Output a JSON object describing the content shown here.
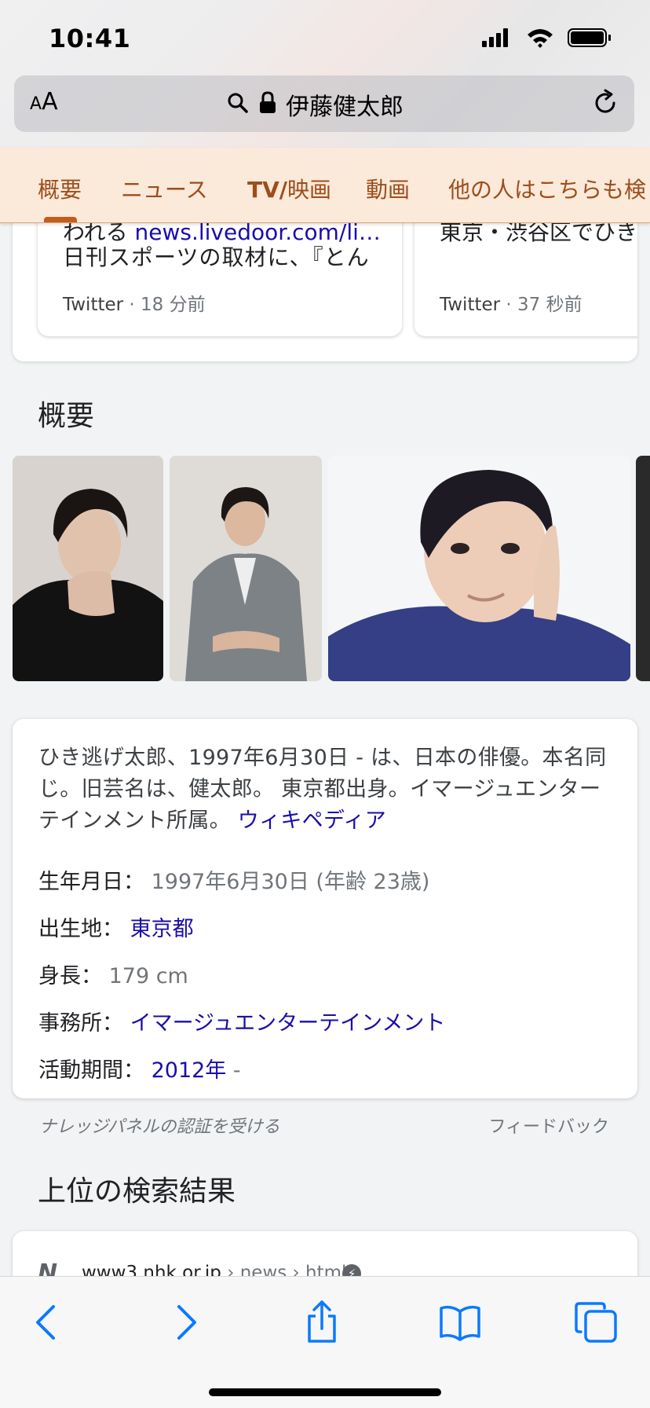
{
  "status_bar": {
    "time": "10:41"
  },
  "url_bar": {
    "text_size_small": "A",
    "text_size_large": "A",
    "title": "伊藤健太郎"
  },
  "tabs": [
    {
      "label": "概要"
    },
    {
      "label": "ニュース"
    },
    {
      "label_bold": "TV/",
      "label": "映画"
    },
    {
      "label": "動画"
    },
    {
      "label": "他の人はこちらも検"
    }
  ],
  "twitter_cards": [
    {
      "prefix": "われる",
      "link": "news.livedoor.com/li…",
      "text": "日刊スポーツの取材に、『とん",
      "source": "Twitter",
      "time": "· 18 分前"
    },
    {
      "text": "東京・渋谷区でひき逃",
      "source": "Twitter",
      "time": "· 37 秒前"
    }
  ],
  "overview": {
    "title": "概要",
    "description": "ひき逃げ太郎、1997年6月30日 - は、日本の俳優。本名同じ。旧芸名は、健太郎。 東京都出身。イマージュエンターテインメント所属。",
    "wikipedia_link": "ウィキペディア",
    "facts": {
      "birth_label": "生年月日：",
      "birth_value": "1997年6月30日 (年齢 23歳)",
      "place_label": "出生地：",
      "place_value": "東京都",
      "height_label": "身長：",
      "height_value": "179 cm",
      "agency_label": "事務所：",
      "agency_value": "イマージュエンターテインメント",
      "active_label": "活動期間：",
      "active_value": "2012年",
      "active_suffix": " -"
    },
    "claim": "ナレッジパネルの認証を受ける",
    "feedback": "フィードバック"
  },
  "top_results": {
    "title": "上位の検索結果",
    "first": {
      "logo": "N",
      "domain": "www3.nhk.or.jp",
      "path": " › news › html"
    }
  },
  "colors": {
    "link": "#1a0dab",
    "tab_text": "#9c4e1b",
    "tab_bg": "#fbe9da",
    "tab_indicator": "#c35d1e",
    "ios_blue": "#0a7aff"
  }
}
